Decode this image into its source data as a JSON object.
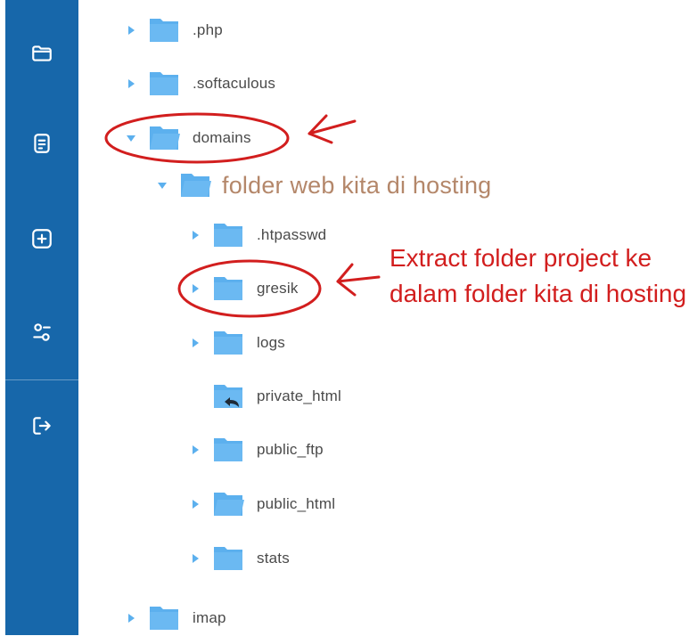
{
  "sidebar": {
    "items": [
      {
        "name": "files",
        "icon": "folder-icon"
      },
      {
        "name": "editor",
        "icon": "document-icon"
      },
      {
        "name": "new",
        "icon": "plus-square-icon"
      },
      {
        "name": "settings",
        "icon": "sliders-icon"
      },
      {
        "name": "logout",
        "icon": "logout-icon"
      }
    ]
  },
  "tree": {
    "items": [
      {
        "label": ".php",
        "expanded": false
      },
      {
        "label": ".softaculous",
        "expanded": false
      },
      {
        "label": "domains",
        "expanded": true
      },
      {
        "label": "folder web kita di hosting",
        "expanded": true
      },
      {
        "label": ".htpasswd",
        "expanded": false
      },
      {
        "label": "gresik",
        "expanded": false
      },
      {
        "label": "logs",
        "expanded": false
      },
      {
        "label": "private_html",
        "symlink": true
      },
      {
        "label": "public_ftp",
        "expanded": false
      },
      {
        "label": "public_html",
        "expanded": false
      },
      {
        "label": "stats",
        "expanded": false
      },
      {
        "label": "imap",
        "expanded": false
      }
    ]
  },
  "annotation": {
    "text": "Extract folder project ke dalam folder kita di hosting"
  },
  "colors": {
    "sidebar": "#1767aa",
    "folder": "#5cb0ee",
    "annotation": "#d21e1e",
    "folder_web_label": "#b4876a"
  }
}
